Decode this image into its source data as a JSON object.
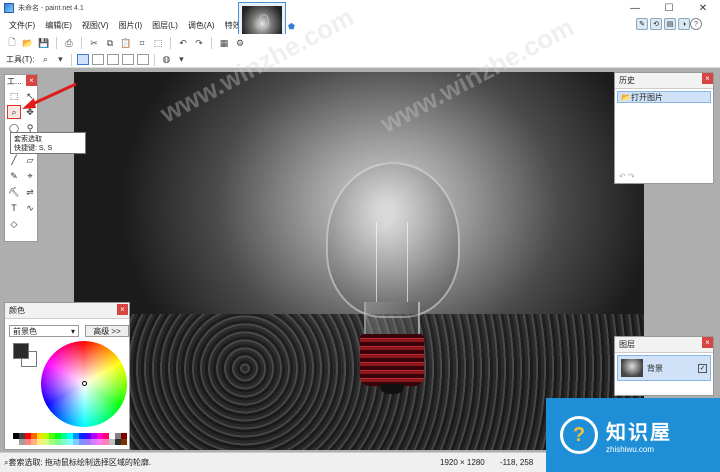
{
  "window": {
    "title": "未命名 - paint.net 4.1"
  },
  "menu": [
    "文件(F)",
    "编辑(E)",
    "视图(V)",
    "图片(I)",
    "图层(L)",
    "调色(A)",
    "特效(C)"
  ],
  "toolbar2": {
    "tools_label": "工具(T):"
  },
  "tools_window": {
    "title": "工..."
  },
  "tooltip": {
    "line1": "套索选取",
    "line2": "快捷键: S, S"
  },
  "history": {
    "title": "历史",
    "items": [
      "打开图片"
    ]
  },
  "layers": {
    "title": "图层",
    "items": [
      "背景"
    ]
  },
  "colors": {
    "title": "颜色",
    "selector": "前景色",
    "advanced_button": "高级 >>"
  },
  "status": {
    "hint": "套索选取: 拖动鼠标绘制选择区域的轮廓.",
    "image_size": "1920 × 1280",
    "cursor": "-118, 258"
  },
  "watermark": {
    "text": "www.winzhe.com"
  },
  "brand": {
    "name": "知识屋",
    "url": "zhishiwu.com"
  }
}
